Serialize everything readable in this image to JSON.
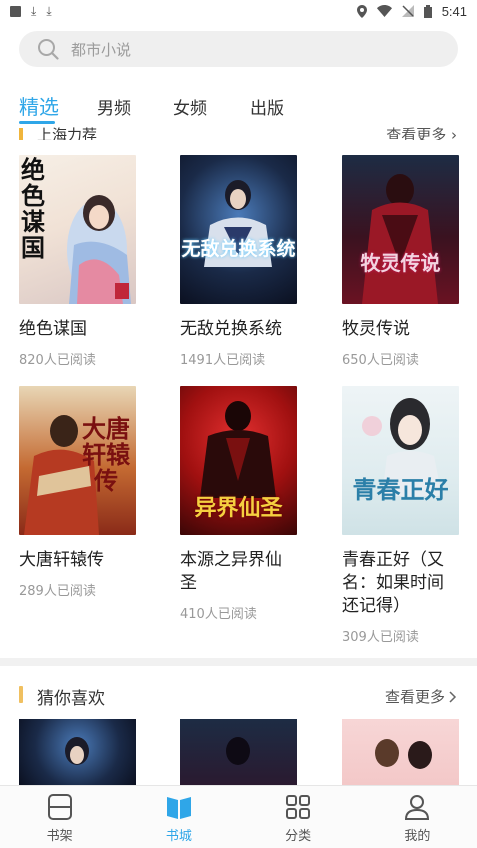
{
  "status_bar": {
    "time": "5:41"
  },
  "search": {
    "placeholder": "都市小说"
  },
  "tabs": [
    {
      "label": "精选",
      "active": true
    },
    {
      "label": "男频",
      "active": false
    },
    {
      "label": "女频",
      "active": false
    },
    {
      "label": "出版",
      "active": false
    }
  ],
  "top_section": {
    "title": "上海力荐",
    "more": "查看更多"
  },
  "books": [
    {
      "title": "绝色谋国",
      "readers": "820人已阅读",
      "cover_text": "绝色谋国"
    },
    {
      "title": "无敌兑换系统",
      "readers": "1491人已阅读",
      "cover_text": "无敌兑换系统"
    },
    {
      "title": "牧灵传说",
      "readers": "650人已阅读",
      "cover_text": "牧灵传说"
    },
    {
      "title": "大唐轩辕传",
      "readers": "289人已阅读",
      "cover_text": "大唐轩辕传"
    },
    {
      "title": "本源之异界仙圣",
      "readers": "410人已阅读",
      "cover_text": "异界仙圣"
    },
    {
      "title": "青春正好（又名：如果时间还记得）",
      "readers": "309人已阅读",
      "cover_text": "青春正好"
    }
  ],
  "guess_section": {
    "title": "猜你喜欢",
    "more": "查看更多"
  },
  "bottom_nav": [
    {
      "label": "书架",
      "icon": "bookshelf-icon",
      "active": false
    },
    {
      "label": "书城",
      "icon": "bookstore-icon",
      "active": true
    },
    {
      "label": "分类",
      "icon": "category-grid-icon",
      "active": false
    },
    {
      "label": "我的",
      "icon": "profile-icon",
      "active": false
    }
  ],
  "colors": {
    "accent": "#2fa6e8",
    "section_bar": "#f0c060",
    "search_bg": "#efefef"
  }
}
